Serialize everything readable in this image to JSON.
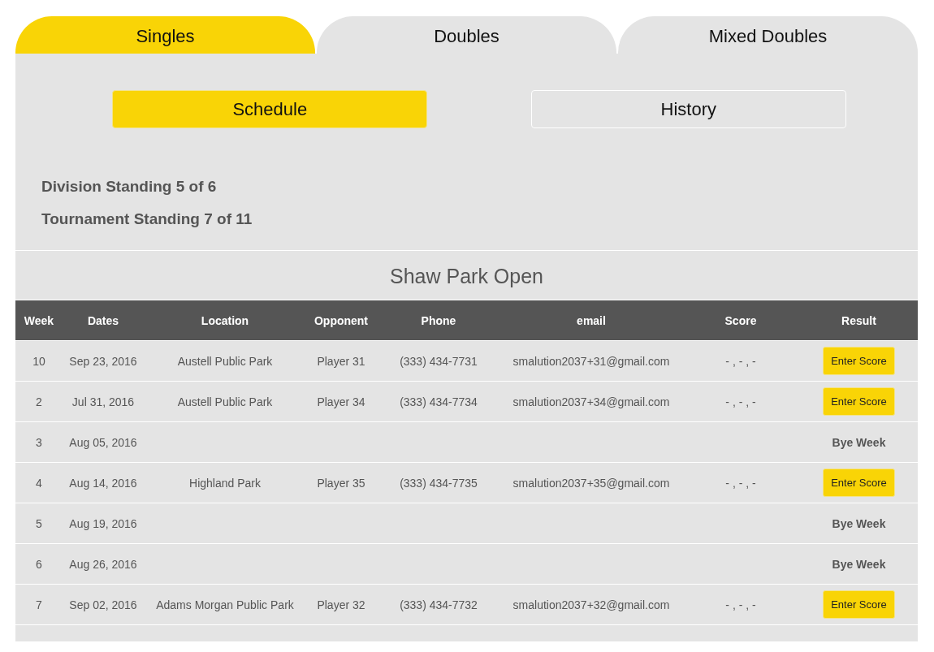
{
  "tabs": [
    {
      "label": "Singles",
      "selected": true
    },
    {
      "label": "Doubles",
      "selected": false
    },
    {
      "label": "Mixed Doubles",
      "selected": false
    }
  ],
  "subtabs": [
    {
      "label": "Schedule",
      "selected": true
    },
    {
      "label": "History",
      "selected": false
    }
  ],
  "standings": [
    "Division Standing 5 of 6",
    "Tournament Standing 7 of 11"
  ],
  "schedule": {
    "title": "Shaw Park Open",
    "columns": [
      "Week",
      "Dates",
      "Location",
      "Opponent",
      "Phone",
      "email",
      "Score",
      "Result"
    ],
    "rows": [
      {
        "week": "10",
        "date": "Sep 23, 2016",
        "location": "Austell Public Park",
        "opponent": "Player 31",
        "phone": "(333) 434-7731",
        "email": "smalution2037+31@gmail.com",
        "score": "- , - , -",
        "result": {
          "kind": "button",
          "label": "Enter Score"
        }
      },
      {
        "week": "2",
        "date": "Jul 31, 2016",
        "location": "Austell Public Park",
        "opponent": "Player 34",
        "phone": "(333) 434-7734",
        "email": "smalution2037+34@gmail.com",
        "score": "- , - , -",
        "result": {
          "kind": "button",
          "label": "Enter Score"
        }
      },
      {
        "week": "3",
        "date": "Aug 05, 2016",
        "result": {
          "kind": "text",
          "label": "Bye Week"
        }
      },
      {
        "week": "4",
        "date": "Aug 14, 2016",
        "location": "Highland Park",
        "opponent": "Player 35",
        "phone": "(333) 434-7735",
        "email": "smalution2037+35@gmail.com",
        "score": "- , - , -",
        "result": {
          "kind": "button",
          "label": "Enter Score"
        }
      },
      {
        "week": "5",
        "date": "Aug 19, 2016",
        "result": {
          "kind": "text",
          "label": "Bye Week"
        }
      },
      {
        "week": "6",
        "date": "Aug 26, 2016",
        "result": {
          "kind": "text",
          "label": "Bye Week"
        }
      },
      {
        "week": "7",
        "date": "Sep 02, 2016",
        "location": "Adams Morgan Public Park",
        "opponent": "Player 32",
        "phone": "(333) 434-7732",
        "email": "smalution2037+32@gmail.com",
        "score": "- , - , -",
        "result": {
          "kind": "button",
          "label": "Enter Score"
        }
      }
    ]
  }
}
